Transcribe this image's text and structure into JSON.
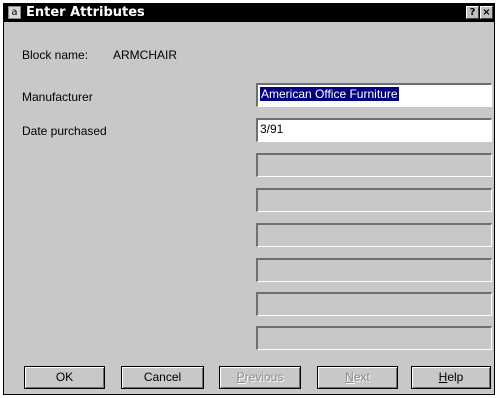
{
  "window": {
    "title": "Enter Attributes",
    "help_label": "?",
    "close_label": "×"
  },
  "block": {
    "label": "Block name:",
    "value": "ARMCHAIR"
  },
  "attributes": [
    {
      "label": "Manufacturer",
      "value": "American Office Furniture"
    },
    {
      "label": "Date purchased",
      "value": "3/91"
    }
  ],
  "buttons": {
    "ok": "OK",
    "cancel": "Cancel",
    "previous_u": "P",
    "previous_rest": "revious",
    "next_u": "N",
    "next_rest": "ext",
    "help_u": "H",
    "help_rest": "elp"
  }
}
